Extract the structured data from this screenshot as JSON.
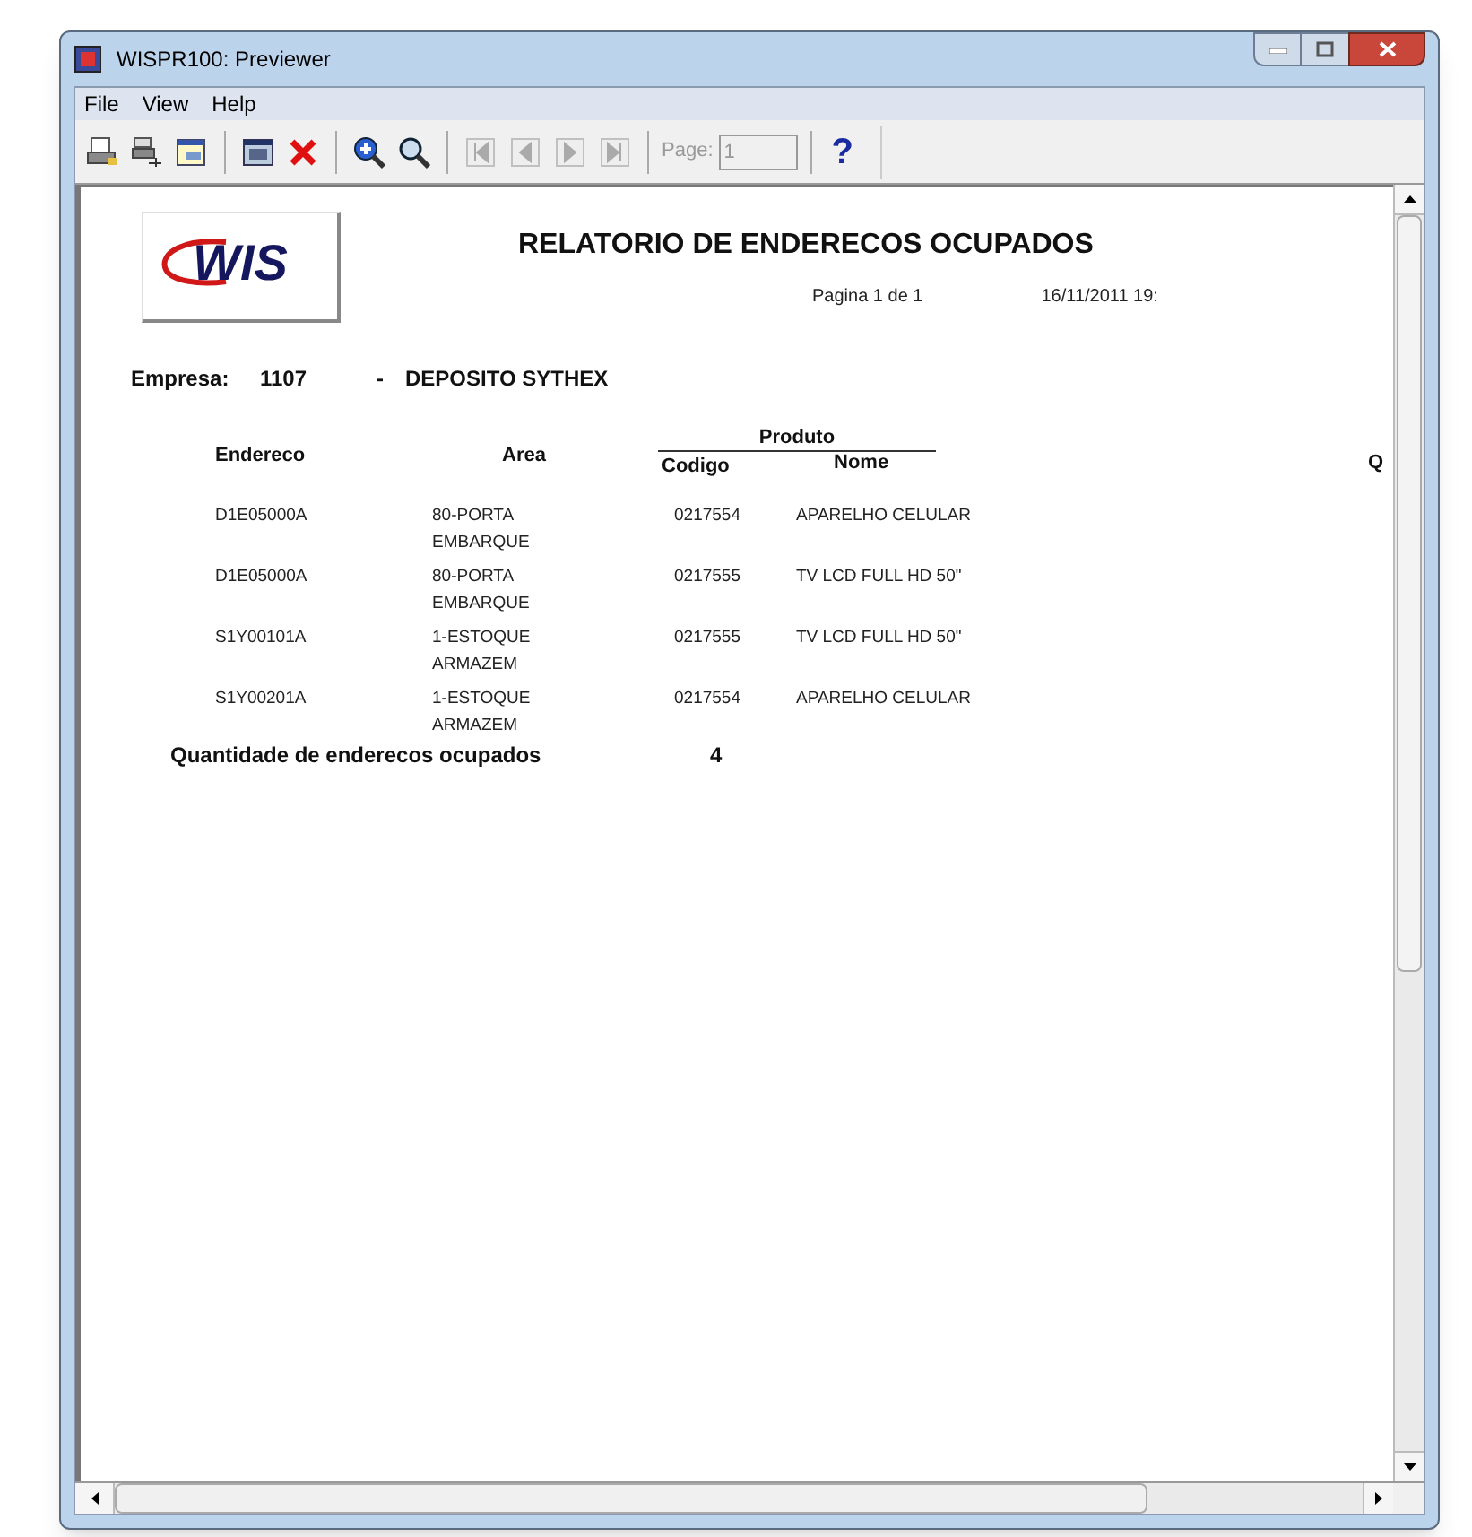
{
  "window": {
    "title": "WISPR100: Previewer"
  },
  "menu": [
    "File",
    "View",
    "Help"
  ],
  "toolbar": {
    "nav_buttons": [
      {
        "disabled": true
      },
      {
        "disabled": true
      },
      {
        "disabled": true
      },
      {
        "disabled": true
      }
    ],
    "page": {
      "label": "Page:",
      "value": "1",
      "disabled": true
    },
    "help": "?"
  },
  "report": {
    "logo": "WIS",
    "title": "RELATORIO DE ENDERECOS OCUPADOS",
    "page_info": "Pagina 1 de 1",
    "date": "16/11/2011 19:",
    "company": {
      "label": "Empresa:",
      "code": "1107",
      "separator": "-",
      "name": "DEPOSITO SYTHEX"
    },
    "group_header": "Produto",
    "columns": [
      "Endereco",
      "Area",
      "Codigo",
      "Nome",
      "Q"
    ],
    "rows": [
      {
        "endereco": "D1E05000A",
        "area": [
          "80-PORTA",
          "EMBARQUE"
        ],
        "codigo": "0217554",
        "nome": "APARELHO CELULAR"
      },
      {
        "endereco": "D1E05000A",
        "area": [
          "80-PORTA",
          "EMBARQUE"
        ],
        "codigo": "0217555",
        "nome": "TV LCD FULL HD 50\""
      },
      {
        "endereco": "S1Y00101A",
        "area": [
          "1-ESTOQUE",
          "ARMAZEM"
        ],
        "codigo": "0217555",
        "nome": "TV LCD FULL HD 50\""
      },
      {
        "endereco": "S1Y00201A",
        "area": [
          "1-ESTOQUE",
          "ARMAZEM"
        ],
        "codigo": "0217554",
        "nome": "APARELHO CELULAR"
      }
    ],
    "summary": {
      "label": "Quantidade de enderecos ocupados",
      "value": "4"
    }
  }
}
